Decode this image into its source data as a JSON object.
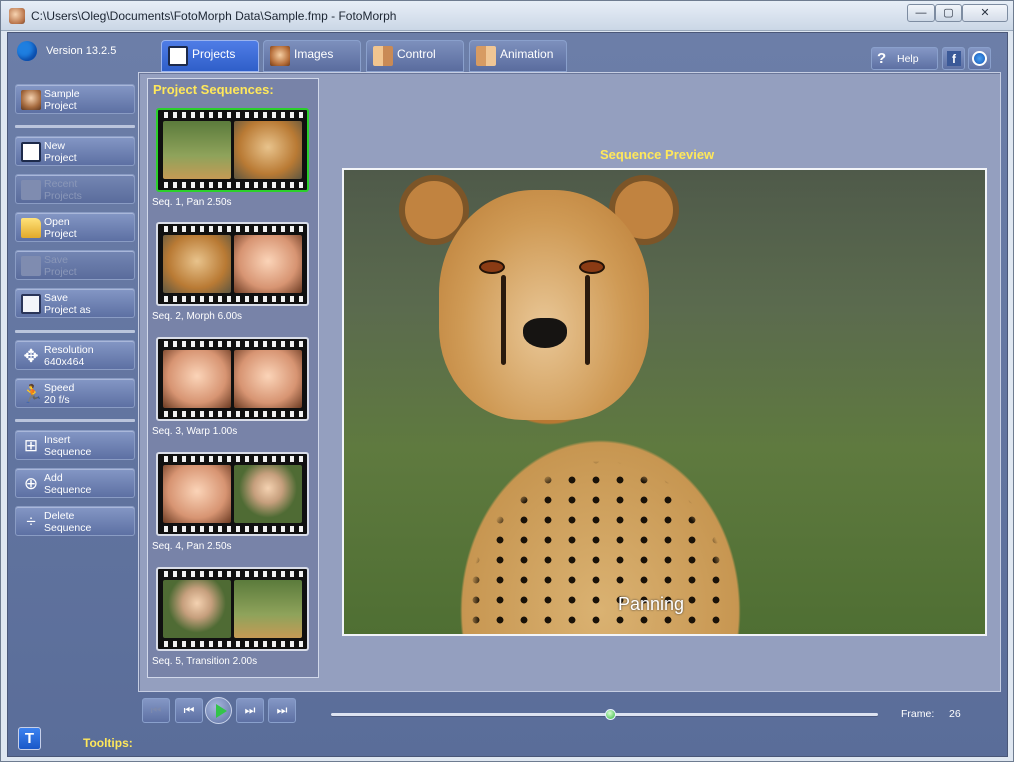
{
  "window": {
    "title": "C:\\Users\\Oleg\\Documents\\FotoMorph Data\\Sample.fmp - FotoMorph",
    "controls": [
      "minimize-icon",
      "maximize-icon",
      "close-icon"
    ],
    "close_glyph": "✕",
    "minimize_glyph": "—",
    "maximize_glyph": "▢"
  },
  "app": {
    "version": "Version 13.2.5"
  },
  "tabs": [
    {
      "label": "Projects",
      "active": true
    },
    {
      "label": "Images",
      "active": false
    },
    {
      "label": "Control",
      "active": false
    },
    {
      "label": "Animation",
      "active": false
    }
  ],
  "header": {
    "help_label": "Help",
    "facebook_glyph": "f"
  },
  "left_buttons": [
    {
      "label": "Sample\nProject",
      "enabled": true
    },
    {
      "label": "New\nProject",
      "enabled": true
    },
    {
      "label": "Recent\nProjects",
      "enabled": false
    },
    {
      "label": "Open\nProject",
      "enabled": true
    },
    {
      "label": "Save\nProject",
      "enabled": false
    },
    {
      "label": "Save\nProject as",
      "enabled": true
    },
    {
      "label": "Resolution\n640x464",
      "enabled": true
    },
    {
      "label": "Speed\n20 f/s",
      "enabled": true
    },
    {
      "label": "Insert\nSequence",
      "enabled": true
    },
    {
      "label": "Add\nSequence",
      "enabled": true
    },
    {
      "label": "Delete\nSequence",
      "enabled": true
    }
  ],
  "sequences": {
    "title": "Project Sequences:",
    "items": [
      {
        "caption": "Seq. 1,  Pan 2.50s",
        "selected": true
      },
      {
        "caption": "Seq. 2,  Morph 6.00s",
        "selected": false
      },
      {
        "caption": "Seq. 3,  Warp 1.00s",
        "selected": false
      },
      {
        "caption": "Seq. 4,  Pan 2.50s",
        "selected": false
      },
      {
        "caption": "Seq. 5,  Transition 2.00s",
        "selected": false
      }
    ]
  },
  "preview": {
    "title": "Sequence Preview",
    "overlay_text": "Panning"
  },
  "transport": {
    "frame_label": "Frame:",
    "frame_value": "26",
    "slider_position": 0.51
  },
  "footer": {
    "tooltips_label": "Tooltips:",
    "tooltips_button": "T"
  },
  "colors": {
    "accent_yellow": "#ffe85a",
    "selected_green": "#2bd02b",
    "tab_active": "#3f6fd8"
  }
}
